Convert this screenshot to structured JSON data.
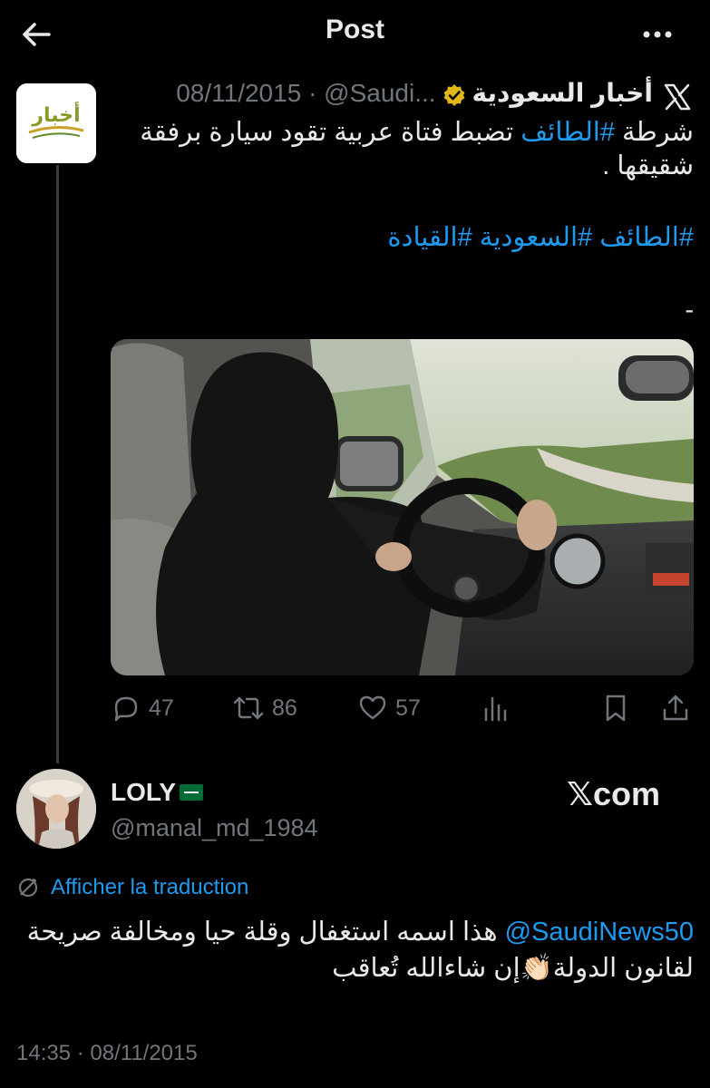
{
  "header": {
    "title": "Post"
  },
  "quoted_tweet": {
    "author_name": "أخبار السعودية",
    "handle": "@Saudi...",
    "separator": "·",
    "date": "08/11/2015",
    "text_prefix": "شرطة ",
    "text_hashtag": "#الطائف",
    "text_rest": " تضبط فتاة عربية تقود سيارة برفقة شقيقها .",
    "hashtags": "#الطائف #السعودية #القيادة",
    "dash": "-",
    "logo_text": "أخبار"
  },
  "actions": {
    "replies": "47",
    "reposts": "86",
    "likes": "57"
  },
  "reply": {
    "display_name": "LOLY",
    "handle": "@manal_md_1984",
    "source": "com",
    "translate_label": "Afficher la traduction",
    "mention": "@SaudiNews50",
    "text": " هذا اسمه استغفال وقلة حيا ومخالفة صريحة لقانون الدولة👏🏻إن شاءالله تُعاقب",
    "timestamp": "14:35 · 08/11/2015"
  },
  "colors": {
    "background": "#000000",
    "text": "#e7e9ea",
    "muted": "#71767b",
    "link": "#1d9bf0",
    "verified": "#e2b719"
  },
  "icons": {
    "back": "arrow-left-icon",
    "more": "more-horizontal-icon",
    "x_logo": "x-logo-icon",
    "verified": "verified-badge-icon",
    "reply": "reply-icon",
    "repost": "repost-icon",
    "like": "heart-icon",
    "views": "analytics-icon",
    "bookmark": "bookmark-icon",
    "share": "share-icon",
    "translate": "translate-icon"
  }
}
